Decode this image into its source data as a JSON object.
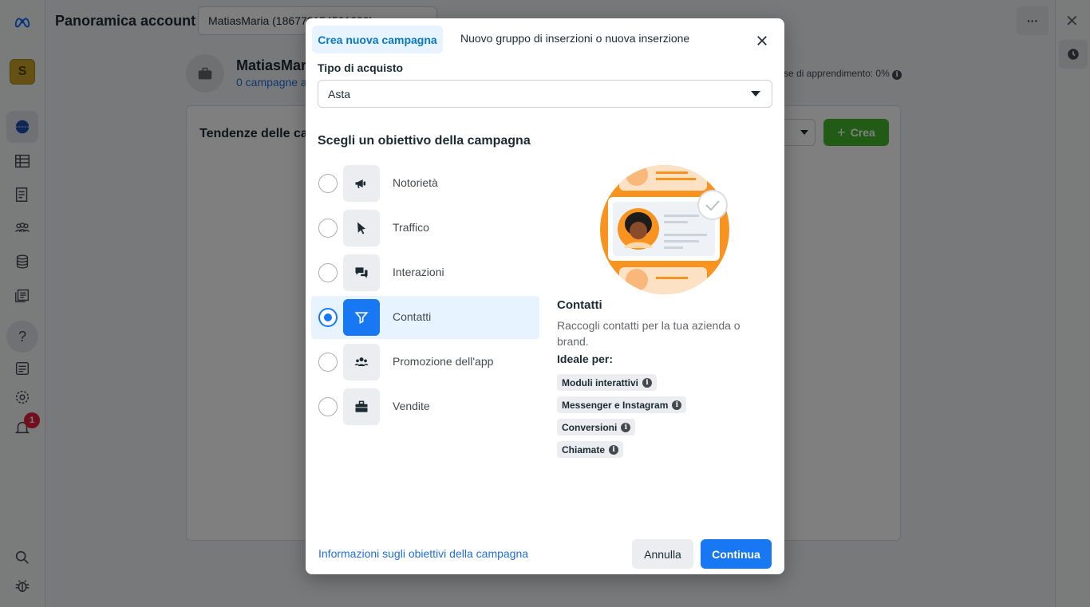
{
  "app": {
    "title": "Panoramica account",
    "account_selector": "MatiasMaria (186773154501080)",
    "more_label": "···"
  },
  "left_rail": {
    "avatar_letter": "S",
    "notification_count": "1",
    "icons": [
      "meta-logo-icon",
      "business-avatar",
      "overview-icon",
      "campaigns-table-icon",
      "pages-icon",
      "audiences-icon",
      "billing-icon",
      "catalog-icon",
      "help-icon",
      "news-icon",
      "settings-icon",
      "notifications-icon",
      "search-icon",
      "bug-icon"
    ]
  },
  "account": {
    "name": "MatiasMaria",
    "campaigns_link": "0 campagne a",
    "learning_text": "se di apprendimento: 0%"
  },
  "trends": {
    "title": "Tendenze delle car",
    "create_label": "Crea"
  },
  "modal": {
    "tabs": {
      "active": "Crea nuova campagna",
      "inactive": "Nuovo gruppo di inserzioni o nuova inserzione"
    },
    "purchase_type": {
      "label": "Tipo di acquisto",
      "value": "Asta"
    },
    "objective_heading": "Scegli un obiettivo della campagna",
    "objectives": [
      {
        "label": "Notorietà",
        "icon": "megaphone-icon",
        "selected": false
      },
      {
        "label": "Traffico",
        "icon": "cursor-icon",
        "selected": false
      },
      {
        "label": "Interazioni",
        "icon": "chat-bubbles-icon",
        "selected": false
      },
      {
        "label": "Contatti",
        "icon": "funnel-icon",
        "selected": true
      },
      {
        "label": "Promozione dell'app",
        "icon": "people-icon",
        "selected": false
      },
      {
        "label": "Vendite",
        "icon": "briefcase-icon",
        "selected": false
      }
    ],
    "detail": {
      "title": "Contatti",
      "description": "Raccogli contatti per la tua azienda o brand.",
      "ideal_label": "Ideale per:",
      "tags": [
        "Moduli interattivi",
        "Messenger e Instagram",
        "Conversioni",
        "Chiamate"
      ]
    },
    "footer": {
      "link": "Informazioni sugli obiettivi della campagna",
      "cancel": "Annulla",
      "continue": "Continua"
    }
  },
  "colors": {
    "primary": "#1877f2",
    "selected_bg": "#e7f3ff",
    "create_green": "#42b72a",
    "illustration_orange": "#f7931e"
  }
}
